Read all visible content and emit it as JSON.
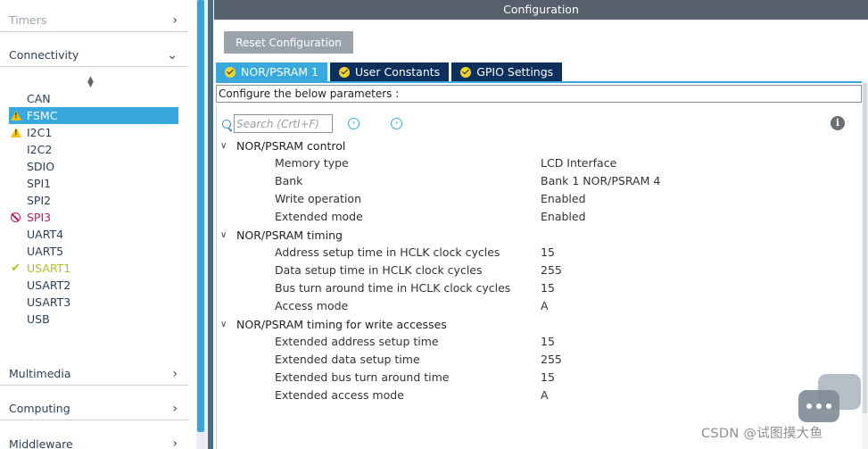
{
  "sidebar": {
    "categories": {
      "timers": "Timers",
      "connectivity": "Connectivity",
      "multimedia": "Multimedia",
      "computing": "Computing",
      "middleware": "Middleware"
    },
    "peripherals": [
      {
        "label": "CAN",
        "status": "none"
      },
      {
        "label": "FSMC",
        "status": "warning"
      },
      {
        "label": "I2C1",
        "status": "warning"
      },
      {
        "label": "I2C2",
        "status": "none"
      },
      {
        "label": "SDIO",
        "status": "none"
      },
      {
        "label": "SPI1",
        "status": "none"
      },
      {
        "label": "SPI2",
        "status": "none"
      },
      {
        "label": "SPI3",
        "status": "disabled"
      },
      {
        "label": "UART4",
        "status": "none"
      },
      {
        "label": "UART5",
        "status": "none"
      },
      {
        "label": "USART1",
        "status": "ok"
      },
      {
        "label": "USART2",
        "status": "none"
      },
      {
        "label": "USART3",
        "status": "none"
      },
      {
        "label": "USB",
        "status": "none"
      }
    ],
    "selected": "FSMC"
  },
  "config": {
    "title": "Configuration",
    "reset_label": "Reset Configuration",
    "tabs": [
      {
        "label": "NOR/PSRAM 1",
        "active": true
      },
      {
        "label": "User Constants",
        "active": false
      },
      {
        "label": "GPIO Settings",
        "active": false
      }
    ],
    "configure_text": "Configure the below parameters :",
    "search_placeholder": "Search (Crtl+F)",
    "groups": [
      {
        "title": "NOR/PSRAM control",
        "params": [
          {
            "name": "Memory type",
            "value": "LCD Interface"
          },
          {
            "name": "Bank",
            "value": "Bank 1 NOR/PSRAM 4"
          },
          {
            "name": "Write operation",
            "value": "Enabled"
          },
          {
            "name": "Extended mode",
            "value": "Enabled"
          }
        ]
      },
      {
        "title": "NOR/PSRAM timing",
        "params": [
          {
            "name": "Address setup time in HCLK clock cycles",
            "value": "15"
          },
          {
            "name": "Data setup time in HCLK clock cycles",
            "value": "255"
          },
          {
            "name": "Bus turn around time in HCLK clock cycles",
            "value": "15"
          },
          {
            "name": "Access mode",
            "value": "A"
          }
        ]
      },
      {
        "title": "NOR/PSRAM timing for write accesses",
        "params": [
          {
            "name": "Extended address setup time",
            "value": "15"
          },
          {
            "name": "Extended data setup time",
            "value": "255"
          },
          {
            "name": "Extended bus turn around time",
            "value": "15"
          },
          {
            "name": "Extended access mode",
            "value": "A"
          }
        ]
      }
    ]
  },
  "watermark": "CSDN @试图摸大鱼",
  "colors": {
    "accent": "#39a9dd",
    "tab_dark": "#0c2f5b",
    "warning": "#f3c300",
    "disabled": "#c2185b",
    "ok": "#a4c81e"
  }
}
